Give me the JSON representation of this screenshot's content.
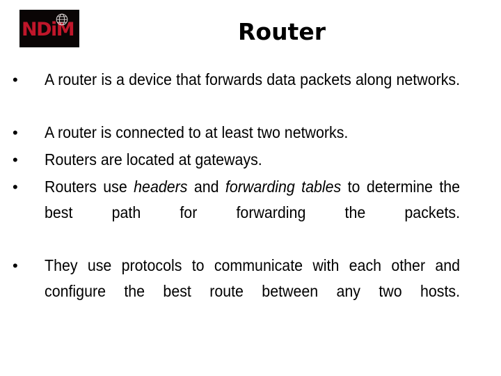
{
  "slide": {
    "title": "Router",
    "logo": {
      "text": "NDiM",
      "icon": "globe-grid-icon",
      "background_color": "#0a0505",
      "text_color": "#c0162a"
    },
    "bullet_marker": "•",
    "bullets": [
      {
        "id": "bullet-1",
        "justified": true,
        "parts": [
          {
            "text": "A router is a device that forwards data packets along networks.",
            "italic": false
          }
        ]
      },
      {
        "id": "bullet-2",
        "justified": false,
        "parts": [
          {
            "text": "A router is connected to at least two networks.",
            "italic": false
          }
        ]
      },
      {
        "id": "bullet-3",
        "justified": false,
        "parts": [
          {
            "text": "Routers are located at gateways.",
            "italic": false
          }
        ]
      },
      {
        "id": "bullet-4",
        "justified": true,
        "parts": [
          {
            "text": "Routers use ",
            "italic": false
          },
          {
            "text": "headers",
            "italic": true
          },
          {
            "text": " and ",
            "italic": false
          },
          {
            "text": "forwarding tables",
            "italic": true
          },
          {
            "text": " to determine the best path for forwarding the packets.",
            "italic": false
          }
        ]
      },
      {
        "id": "bullet-5",
        "justified": true,
        "parts": [
          {
            "text": "They use protocols to communicate with each other and configure the best route between any two hosts.",
            "italic": false
          }
        ]
      }
    ]
  }
}
